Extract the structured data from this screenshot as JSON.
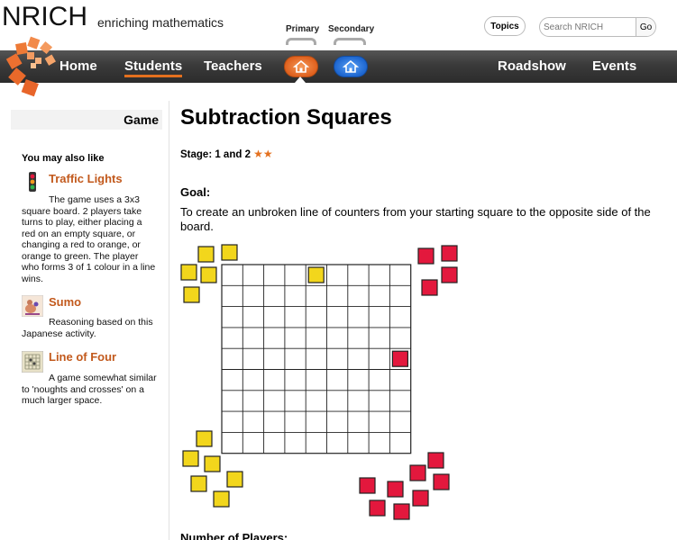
{
  "brand": {
    "name": "NRICH",
    "tagline": "enriching mathematics"
  },
  "header": {
    "primary_label": "Primary",
    "secondary_label": "Secondary",
    "topics_label": "Topics",
    "search_placeholder": "Search NRICH",
    "go_label": "Go"
  },
  "nav": {
    "home": "Home",
    "students": "Students",
    "teachers": "Teachers",
    "roadshow": "Roadshow",
    "events": "Events",
    "active": "Students"
  },
  "sidebar": {
    "heading": "Game",
    "also_like": "You may also like",
    "items": [
      {
        "title": "Traffic Lights",
        "icon": "traffic-light-icon",
        "description": "The game uses a 3x3 square board. 2 players take turns to play, either placing a red on an empty square, or changing a red to orange, or orange to green. The player who forms 3 of 1 colour in a line wins."
      },
      {
        "title": "Sumo",
        "icon": "sumo-icon",
        "description": "Reasoning based on this Japanese activity."
      },
      {
        "title": "Line of Four",
        "icon": "grid-board-icon",
        "description": "A game somewhat similar to 'noughts and crosses' on a much larger space."
      }
    ]
  },
  "main": {
    "title": "Subtraction Squares",
    "stage": "Stage: 1 and 2",
    "stars": "★★",
    "goal_heading": "Goal:",
    "goal_text": "To create an unbroken line of counters from your starting square to the opposite side of the board.",
    "players_heading": "Number of Players:"
  },
  "board": {
    "rows": 9,
    "cols": 9,
    "counter_colors": {
      "yellow": "#f2d61c",
      "red": "#e3183d"
    },
    "placed": [
      {
        "row": 0,
        "col": 4,
        "color": "yellow"
      },
      {
        "row": 4,
        "col": 8,
        "color": "red"
      }
    ]
  },
  "colors": {
    "accent": "#e4701e",
    "link": "#c2591c",
    "nav_bg": "#3a3a3a"
  }
}
